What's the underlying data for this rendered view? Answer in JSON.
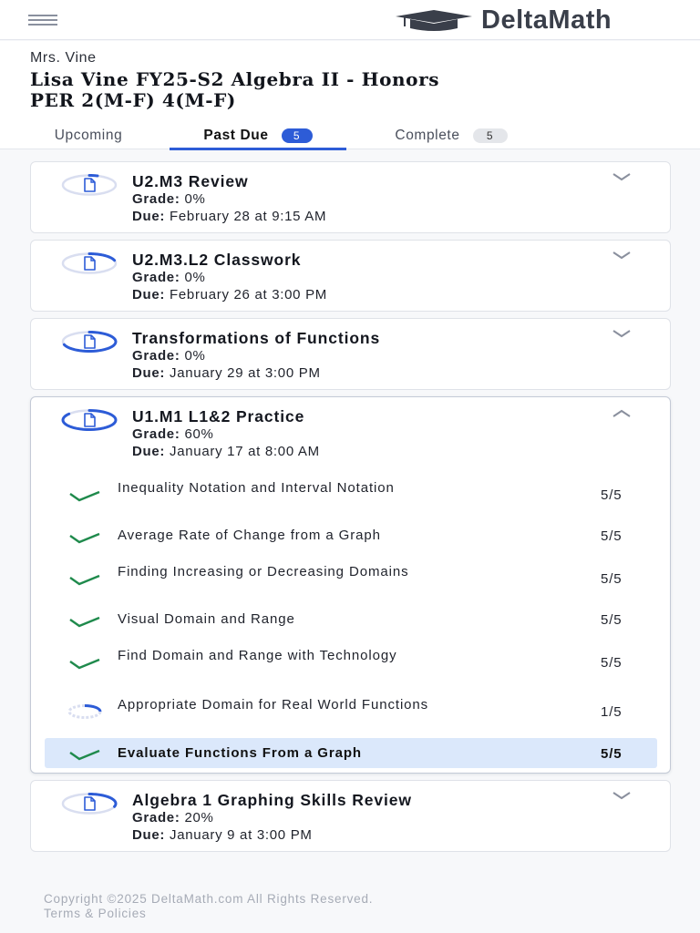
{
  "brand": {
    "name": "DeltaMath"
  },
  "header": {
    "teacher": "Mrs. Vine",
    "class_line1": "Lisa Vine FY25-S2 Algebra II - Honors",
    "class_line2": "PER 2(M-F) 4(M-F)"
  },
  "tabs": [
    {
      "label": "Upcoming",
      "count": null,
      "active": false
    },
    {
      "label": "Past Due",
      "count": "5",
      "active": true
    },
    {
      "label": "Complete",
      "count": "5",
      "active": false
    }
  ],
  "labels": {
    "grade": "Grade:",
    "due": "Due:"
  },
  "assignments": [
    {
      "title": "U2.M3 Review",
      "grade": "0%",
      "due": "February 28 at 9:15 AM",
      "expanded": false,
      "progress": 0.05
    },
    {
      "title": "U2.M3.L2 Classwork",
      "grade": "0%",
      "due": "February 26 at 3:00 PM",
      "expanded": false,
      "progress": 0.2
    },
    {
      "title": "Transformations of Functions",
      "grade": "0%",
      "due": "January 29 at 3:00 PM",
      "expanded": false,
      "progress": 0.7
    },
    {
      "title": "U1.M1 L1&2 Practice",
      "grade": "60%",
      "due": "January 17 at 8:00 AM",
      "expanded": true,
      "progress": 0.86,
      "skills": [
        {
          "name": "Inequality Notation and Interval Notation",
          "score": "5/5",
          "status": "complete"
        },
        {
          "name": "Average Rate of Change from a Graph",
          "score": "5/5",
          "status": "complete"
        },
        {
          "name": "Finding Increasing or Decreasing Domains",
          "score": "5/5",
          "status": "complete"
        },
        {
          "name": "Visual Domain and Range",
          "score": "5/5",
          "status": "complete"
        },
        {
          "name": "Find Domain and Range with Technology",
          "score": "5/5",
          "status": "complete"
        },
        {
          "name": "Appropriate Domain for Real World Functions",
          "score": "1/5",
          "status": "in-progress"
        },
        {
          "name": "Evaluate Functions From a Graph",
          "score": "5/5",
          "status": "complete",
          "selected": true
        }
      ]
    },
    {
      "title": "Algebra 1 Graphing Skills Review",
      "grade": "20%",
      "due": "January 9 at 3:00 PM",
      "expanded": false,
      "progress": 0.3
    }
  ],
  "footer": {
    "copyright": "Copyright ©2025 DeltaMath.com All Rights Reserved.",
    "terms": "Terms & Policies"
  },
  "colors": {
    "accent": "#2d5cd7",
    "check": "#1f8a4c",
    "selected_row": "#dbe8fb",
    "ring_track": "#d9def0"
  },
  "icons": {
    "menu": "hamburger-icon",
    "brand": "graduation-cap-icon",
    "assignment": "document-progress-ring-icon",
    "complete": "checkmark-icon",
    "in_progress": "progress-ring-icon",
    "expand": "chevron-down-icon",
    "collapse": "chevron-up-icon"
  }
}
